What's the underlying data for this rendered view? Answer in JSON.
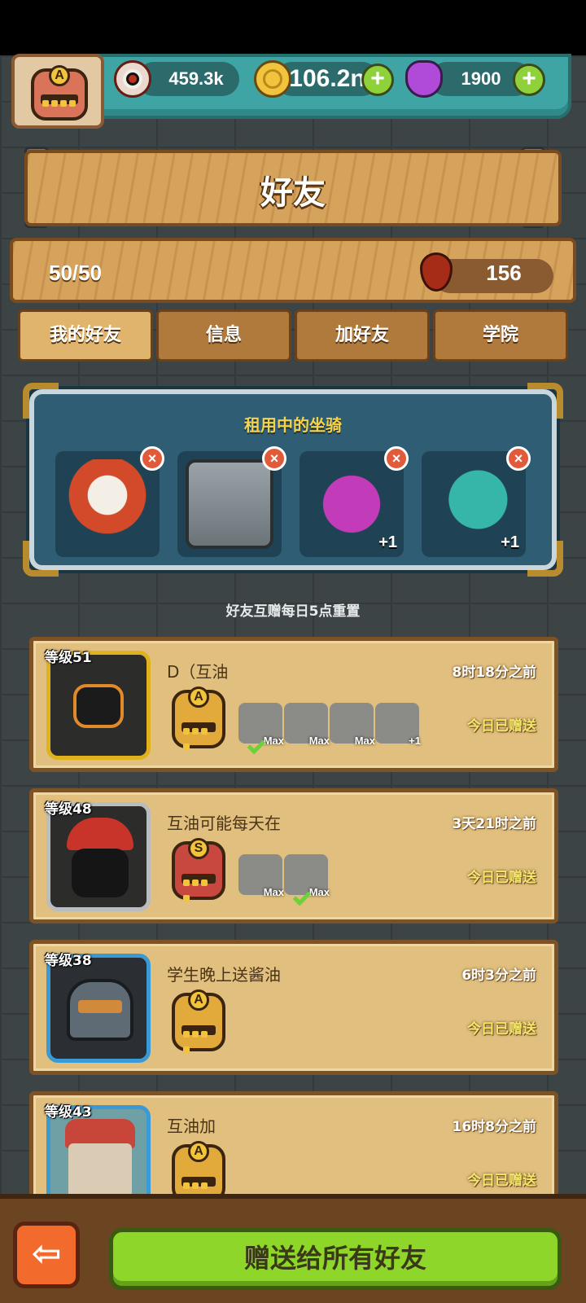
{
  "resources": {
    "eyeballs": "459.3k",
    "coins": "106.2n",
    "potion": "1900"
  },
  "player_badge_letter": "A",
  "title": "好友",
  "friends_count": "50/50",
  "blood_value": "156",
  "tabs": [
    {
      "label": "我的好友",
      "active": true
    },
    {
      "label": "信息",
      "active": false
    },
    {
      "label": "加好友",
      "active": false
    },
    {
      "label": "学院",
      "active": false
    }
  ],
  "rented_mounts": {
    "title": "租用中的坐骑",
    "remove_label": "×",
    "mounts": [
      {
        "name": "lion-dance-mount",
        "plus": ""
      },
      {
        "name": "machine-mount",
        "plus": ""
      },
      {
        "name": "purple-demon-mount",
        "plus": "+1"
      },
      {
        "name": "teal-dragon-mount",
        "plus": "+1"
      }
    ]
  },
  "reset_note": "好友互赠每日5点重置",
  "friends": [
    {
      "level": "等级51",
      "name": "D（互油",
      "last_seen": "8时18分之前",
      "status": "今日已赠送",
      "badge_letter": "A",
      "mount_labels": [
        "Max",
        "Max",
        "Max",
        "+1"
      ]
    },
    {
      "level": "等级48",
      "name": "互油可能每天在",
      "last_seen": "3天21时之前",
      "status": "今日已赠送",
      "badge_letter": "S",
      "mount_labels": [
        "Max",
        "Max"
      ]
    },
    {
      "level": "等级38",
      "name": "学生晚上送酱油",
      "last_seen": "6时3分之前",
      "status": "今日已赠送",
      "badge_letter": "A",
      "mount_labels": []
    },
    {
      "level": "等级43",
      "name": "互油加",
      "last_seen": "16时8分之前",
      "status": "今日已赠送",
      "badge_letter": "A",
      "mount_labels": []
    }
  ],
  "back_icon_glyph": "⇦",
  "give_all_label": "赠送给所有好友",
  "plus_glyph": "+",
  "colors": {
    "accent_green": "#8ed629",
    "wood": "#d6a35d",
    "panel_blue": "#2f5d73",
    "gold_text": "#f4d34b"
  }
}
